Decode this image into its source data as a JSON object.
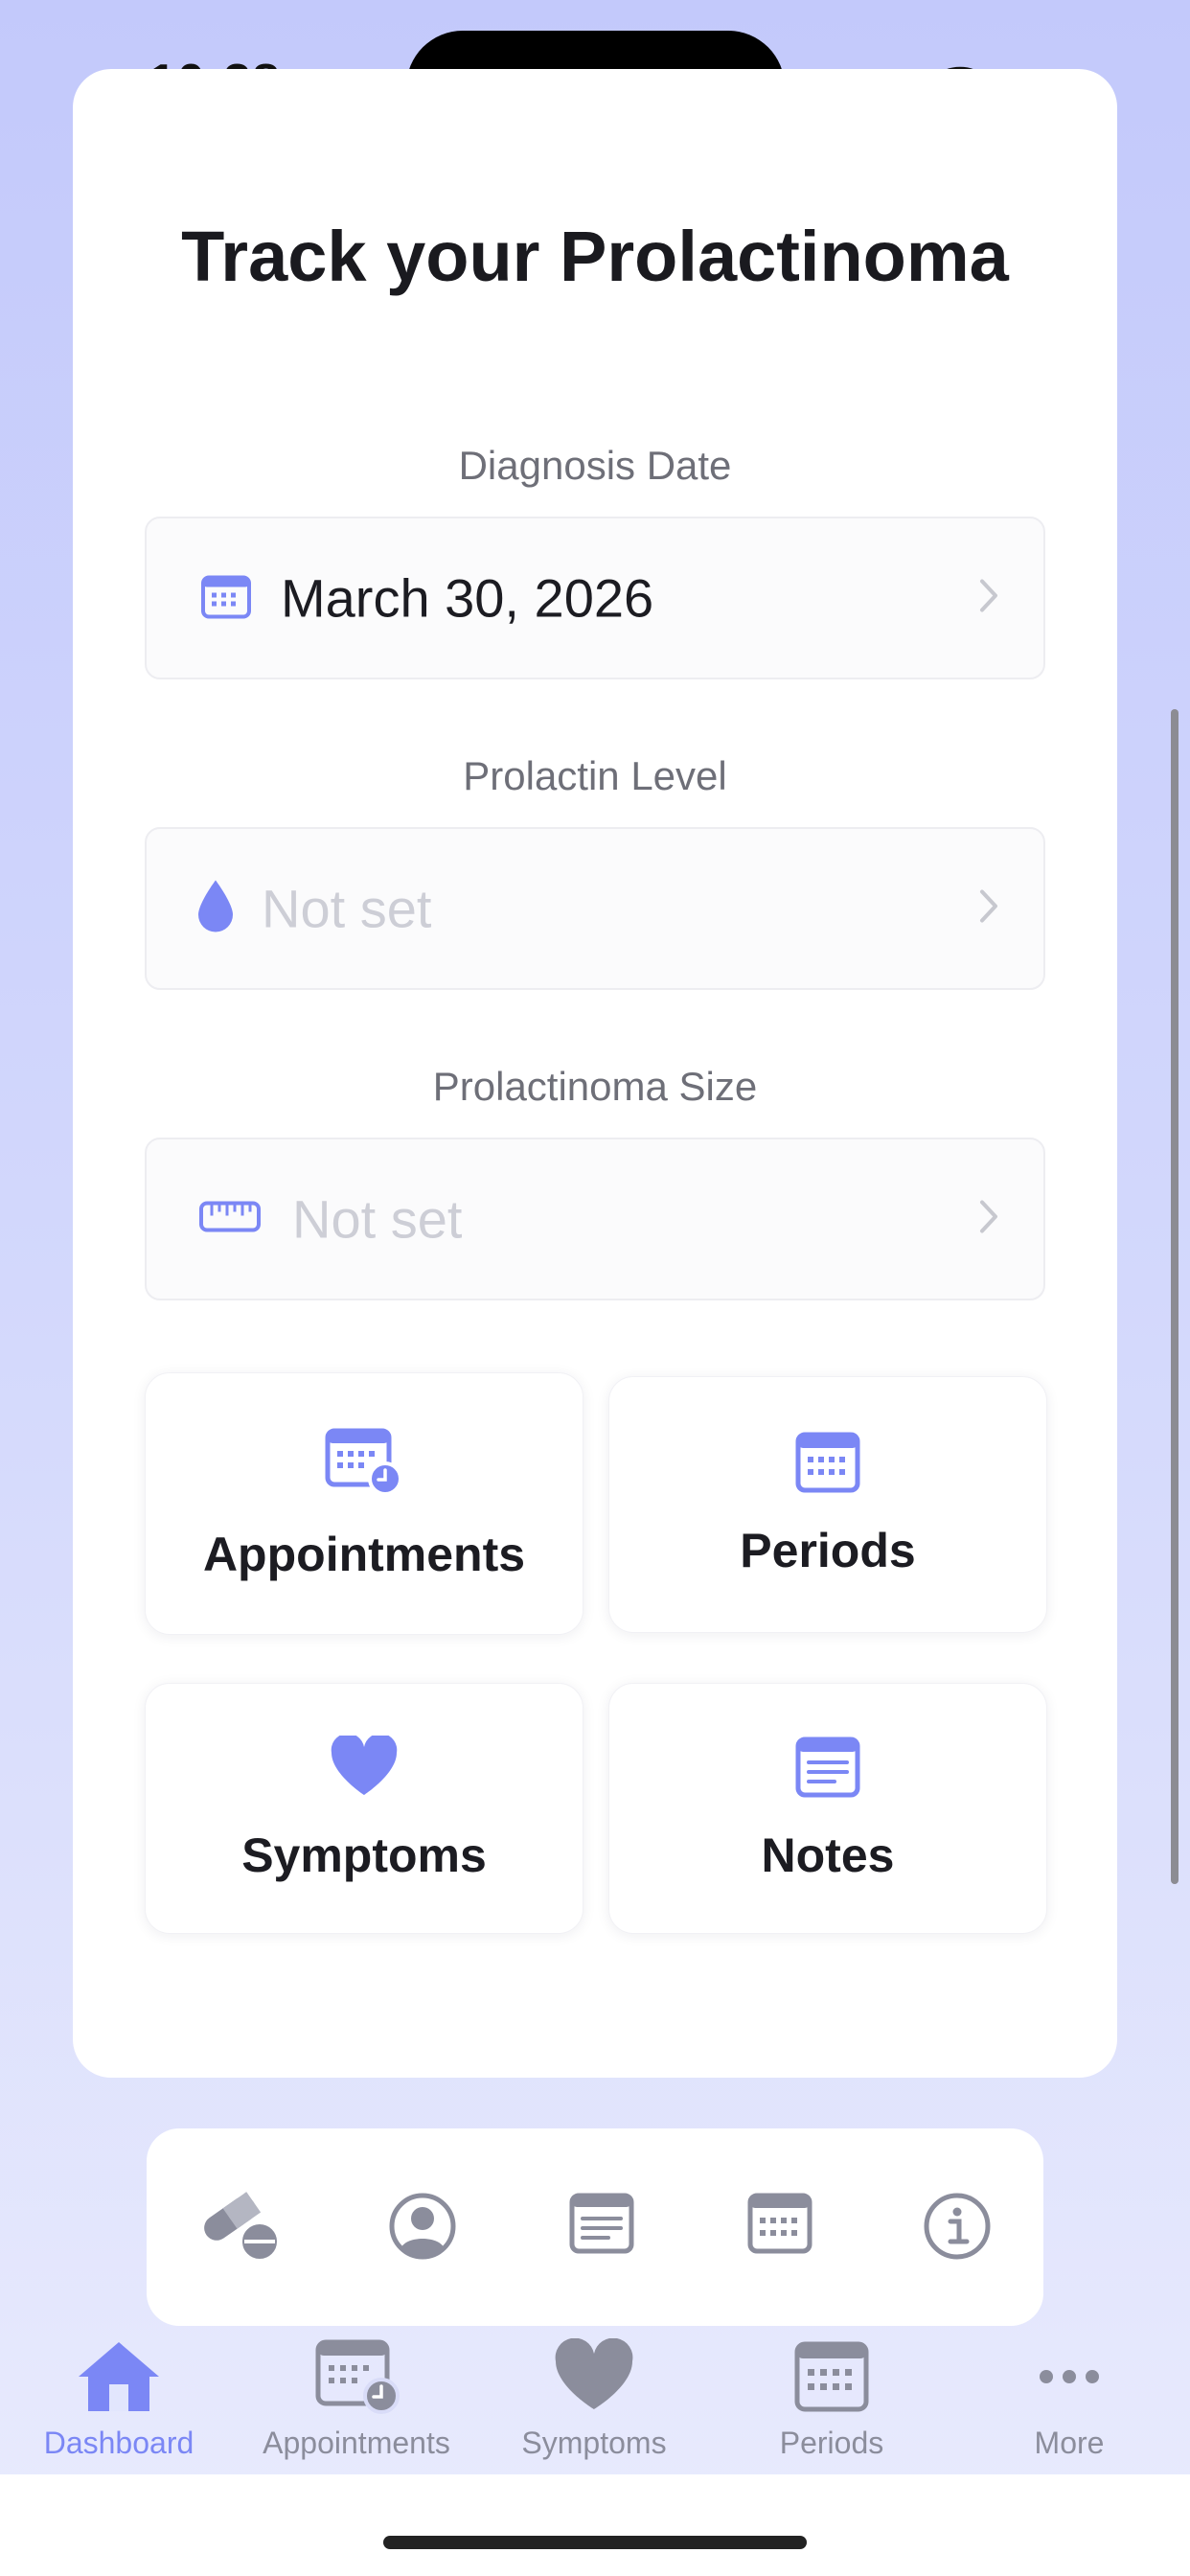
{
  "status_bar": {
    "time": "10:38"
  },
  "page": {
    "title": "Track your Prolactinoma"
  },
  "fields": [
    {
      "label": "Diagnosis Date",
      "value": "March 30, 2026",
      "icon": "calendar-icon",
      "state": "set"
    },
    {
      "label": "Prolactin Level",
      "value": "Not set",
      "icon": "drop-icon",
      "state": "unset"
    },
    {
      "label": "Prolactinoma Size",
      "value": "Not set",
      "icon": "ruler-icon",
      "state": "unset"
    }
  ],
  "tiles": [
    {
      "label": "Appointments",
      "icon": "calendar-clock-icon"
    },
    {
      "label": "Periods",
      "icon": "calendar-icon"
    },
    {
      "label": "Symptoms",
      "icon": "heart-icon"
    },
    {
      "label": "Notes",
      "icon": "note-icon"
    }
  ],
  "toolbar": {
    "items": [
      "pills-icon",
      "person-circle-icon",
      "note-icon",
      "calendar-icon",
      "info-icon"
    ]
  },
  "tab_bar": {
    "tabs": [
      {
        "label": "Dashboard",
        "icon": "house-icon",
        "active": true
      },
      {
        "label": "Appointments",
        "icon": "calendar-clock-icon",
        "active": false
      },
      {
        "label": "Symptoms",
        "icon": "heart-icon",
        "active": false
      },
      {
        "label": "Periods",
        "icon": "calendar-icon",
        "active": false
      },
      {
        "label": "More",
        "icon": "ellipsis-icon",
        "active": false
      }
    ]
  },
  "colors": {
    "accent": "#7b87f5",
    "icon_gray": "#8b8d9c",
    "placeholder": "#cdced6"
  }
}
